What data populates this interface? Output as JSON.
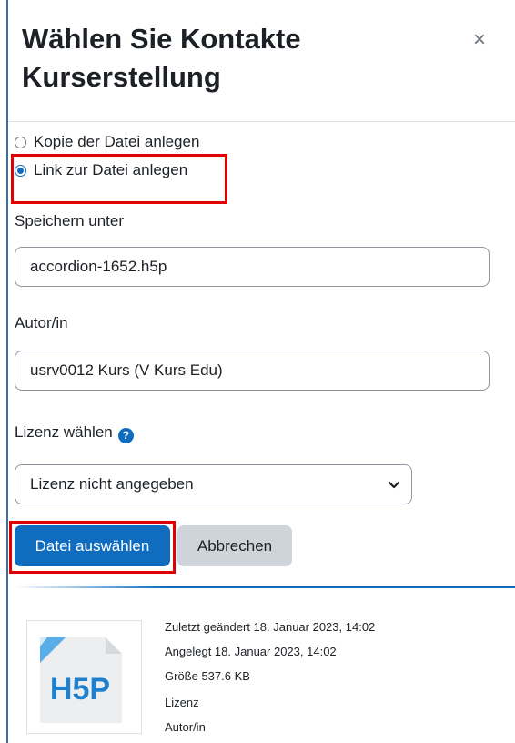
{
  "dialog": {
    "title": "Wählen Sie Kontakte Kurserstellung",
    "close_glyph": "×"
  },
  "options": [
    {
      "label": "Kopie der Datei anlegen",
      "checked": false
    },
    {
      "label": "Link zur Datei anlegen",
      "checked": true
    }
  ],
  "save_as": {
    "label": "Speichern unter",
    "value": "accordion-1652.h5p"
  },
  "author": {
    "label": "Autor/in",
    "value": "usrv0012 Kurs (V Kurs Edu)"
  },
  "license": {
    "label": "Lizenz wählen",
    "help_icon": "question-circle-icon",
    "selected": "Lizenz nicht angegeben"
  },
  "buttons": {
    "select_file": "Datei auswählen",
    "cancel": "Abbrechen"
  },
  "file_info": {
    "thumbnail_icon": "h5p-file-icon",
    "thumbnail_text": "H5P",
    "modified": "Zuletzt geändert 18. Januar 2023, 14:02",
    "created": "Angelegt 18. Januar 2023, 14:02",
    "size": "Größe 537.6 KB",
    "license_label": "Lizenz",
    "author_label": "Autor/in"
  },
  "colors": {
    "primary": "#0f6cbf",
    "highlight": "#e00000",
    "secondary_button": "#ced4da"
  }
}
